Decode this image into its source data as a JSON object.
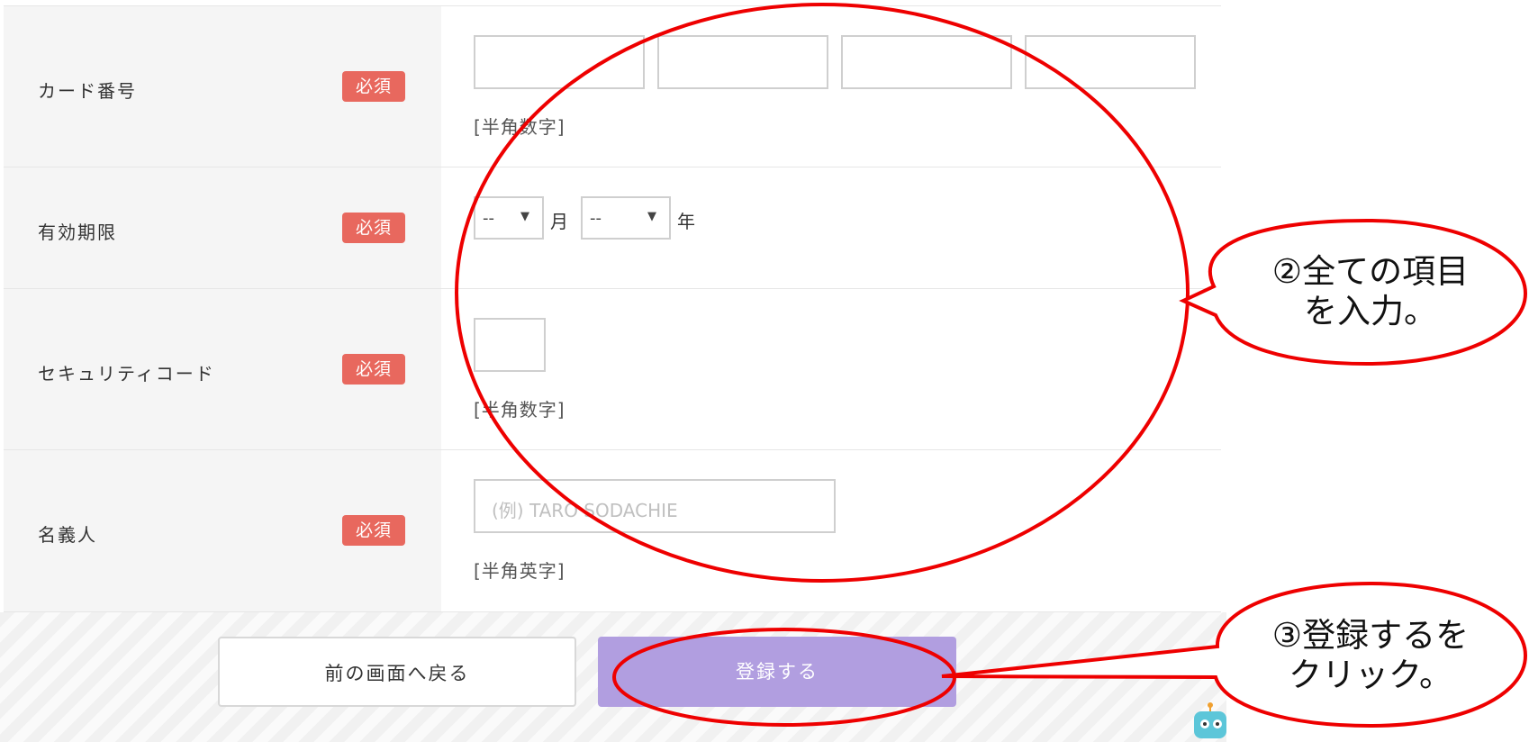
{
  "form": {
    "rows": [
      {
        "label": "カード番号",
        "badge": "必須",
        "hint": "[半角数字]"
      },
      {
        "label": "有効期限",
        "badge": "必須",
        "month_value": "--",
        "month_unit": "月",
        "year_value": "--",
        "year_unit": "年"
      },
      {
        "label": "セキュリティコード",
        "badge": "必須",
        "hint": "[半角数字]"
      },
      {
        "label": "名義人",
        "badge": "必須",
        "placeholder": "(例) TARO SODACHIE",
        "hint": "[半角英字]"
      }
    ]
  },
  "footer": {
    "back_label": "前の画面へ戻る",
    "submit_label": "登録する"
  },
  "annotations": {
    "callout_inputs_line1": "②全ての項目",
    "callout_inputs_line2": "を入力。",
    "callout_submit_line1": "③登録するを",
    "callout_submit_line2": "クリック。"
  },
  "colors": {
    "badge": "#e8685e",
    "submit": "#b19ee0",
    "annotation": "#ee0000"
  }
}
